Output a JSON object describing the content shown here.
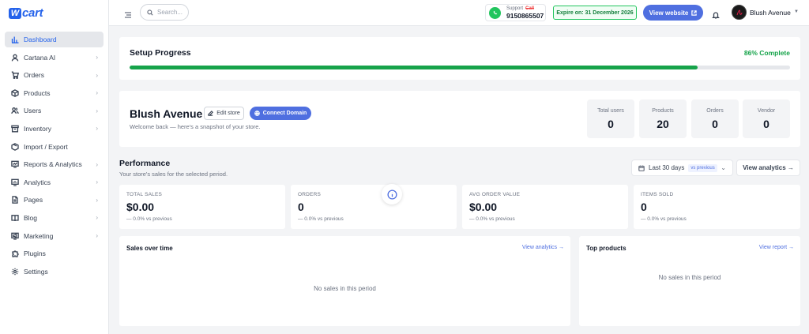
{
  "brand": {
    "logo_letter": "W",
    "logo_text": "cart"
  },
  "sidebar": {
    "items": [
      {
        "label": "Dashboard",
        "icon": "bar-chart-icon",
        "active": true,
        "chevron": false
      },
      {
        "label": "Cartana AI",
        "icon": "user-icon",
        "chevron": true
      },
      {
        "label": "Orders",
        "icon": "cart-icon",
        "chevron": true
      },
      {
        "label": "Products",
        "icon": "box-icon",
        "chevron": true
      },
      {
        "label": "Users",
        "icon": "users-icon",
        "chevron": true
      },
      {
        "label": "Inventory",
        "icon": "archive-icon",
        "chevron": true
      },
      {
        "label": "Import / Export",
        "icon": "package-icon",
        "chevron": false
      },
      {
        "label": "Reports & Analytics",
        "icon": "report-icon",
        "chevron": true
      },
      {
        "label": "Analytics",
        "icon": "analytics-icon",
        "chevron": true
      },
      {
        "label": "Pages",
        "icon": "file-icon",
        "chevron": true
      },
      {
        "label": "Blog",
        "icon": "book-icon",
        "chevron": true
      },
      {
        "label": "Marketing",
        "icon": "megaphone-icon",
        "chevron": true
      },
      {
        "label": "Plugins",
        "icon": "puzzle-icon",
        "chevron": false
      },
      {
        "label": "Settings",
        "icon": "gear-icon",
        "chevron": false
      }
    ]
  },
  "topbar": {
    "search_placeholder": "Search...",
    "support_label": "Support",
    "support_call": "Call",
    "support_phone": "9150865507",
    "expire_text": "Expire on: 31 December 2026",
    "view_website": "View website",
    "user_name": "Blush Avenue"
  },
  "setup": {
    "title": "Setup Progress",
    "percent_text": "86% Complete",
    "progress": 0.86
  },
  "store": {
    "name": "Blush Avenue",
    "edit_label": "Edit store",
    "connect_label": "Connect Domain",
    "welcome": "Welcome back — here's a snapshot of your store.",
    "stats": [
      {
        "label": "Total users",
        "value": "0"
      },
      {
        "label": "Products",
        "value": "20"
      },
      {
        "label": "Orders",
        "value": "0"
      },
      {
        "label": "Vendor",
        "value": "0"
      }
    ]
  },
  "performance": {
    "title": "Performance",
    "subtitle": "Your store's sales for the selected period.",
    "range_label": "Last 30 days",
    "range_badge": "vs previous",
    "view_analytics": "View analytics →",
    "kpis": [
      {
        "label": "Total sales",
        "value": "$0.00",
        "delta": "— 0.0% vs previous"
      },
      {
        "label": "Orders",
        "value": "0",
        "delta": "— 0.0% vs previous"
      },
      {
        "label": "Avg order value",
        "value": "$0.00",
        "delta": "— 0.0% vs previous"
      },
      {
        "label": "Items sold",
        "value": "0",
        "delta": "— 0.0% vs previous"
      }
    ]
  },
  "sales_panel": {
    "title": "Sales over time",
    "link": "View analytics →",
    "empty": "No sales in this period"
  },
  "top_panel": {
    "title": "Top products",
    "link": "View report →",
    "empty": "No sales in this period"
  },
  "colors": {
    "accent": "#4f6fe0",
    "success": "#16a34a",
    "brand": "#2563eb"
  }
}
